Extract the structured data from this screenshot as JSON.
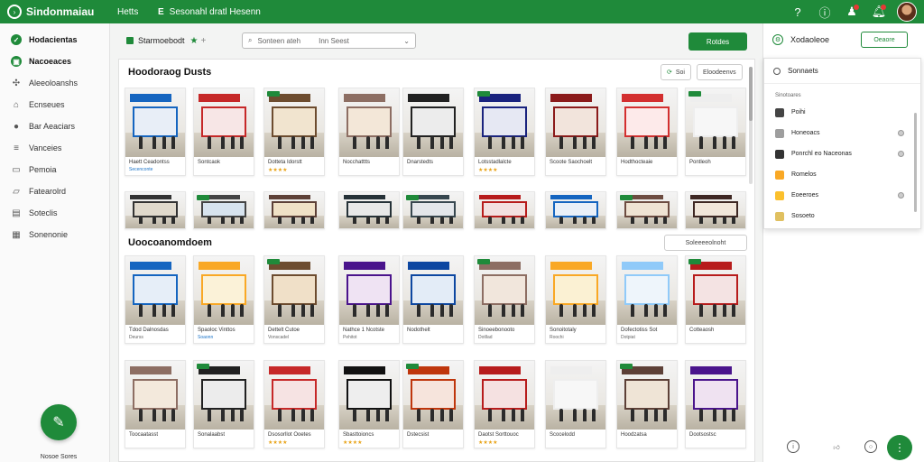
{
  "app": {
    "title": "Sindonmaiau",
    "links": [
      "Hetts",
      "E",
      "Sesonahl dratl Hesenn"
    ]
  },
  "sidebar": {
    "items": [
      {
        "label": "Hodacientas",
        "icon": "check-icon",
        "primary": true
      },
      {
        "label": "Nacoeaces",
        "icon": "store-icon",
        "primary": true
      },
      {
        "label": "Aleeoloanshs",
        "icon": "grid-icon",
        "primary": false
      },
      {
        "label": "Ecnseues",
        "icon": "home-icon",
        "primary": false
      },
      {
        "label": "Bar Aeaciars",
        "icon": "circle-icon",
        "primary": false
      },
      {
        "label": "Vanceies",
        "icon": "list-icon",
        "primary": false
      },
      {
        "label": "Pemoia",
        "icon": "doc-icon",
        "primary": false
      },
      {
        "label": "Fatearolrd",
        "icon": "folder-icon",
        "primary": false
      },
      {
        "label": "Soteclis",
        "icon": "table-icon",
        "primary": false
      },
      {
        "label": "Sonenonie",
        "icon": "settings-icon",
        "primary": false
      }
    ],
    "fab_label": "Nosoe Sores"
  },
  "toolbar": {
    "breadcrumb": "Starmoebodt",
    "search_text": "Sonteen ateh",
    "search_text2": "Inn Seest",
    "primary_button": "Rotdes"
  },
  "section1": {
    "title": "Hoodoraog Dusts",
    "btn_a": "Soi",
    "btn_b": "Eloodeenvs",
    "row1": [
      {
        "cap": "Haett Ceadontss",
        "sub": "Secenconte",
        "kind": "sub",
        "sign": "#1565c0",
        "win": "#e8eef7"
      },
      {
        "cap": "Sontcaok",
        "sub": "",
        "kind": "none",
        "sign": "#c62828",
        "win": "#f7e6e6"
      },
      {
        "cap": "Dotteta Idorstt",
        "sub": "★★★★",
        "kind": "stars",
        "sign": "#6d4c2f",
        "win": "#f1e4cf"
      },
      {
        "cap": "Nocchatttts",
        "sub": "",
        "kind": "none",
        "sign": "#8d6e63",
        "win": "#f3e7d8"
      },
      {
        "cap": "Dnarstedts",
        "sub": "",
        "kind": "none",
        "sign": "#212121",
        "win": "#ececec"
      },
      {
        "cap": "Lotsstadlalcte",
        "sub": "★★★★",
        "kind": "stars",
        "sign": "#1a237e",
        "win": "#e6e8f3"
      },
      {
        "cap": "Scoote Saochoelt",
        "sub": "",
        "kind": "none",
        "sign": "#8b1a1a",
        "win": "#f2e4dc"
      },
      {
        "cap": "Hodthocteaie",
        "sub": "",
        "kind": "none",
        "sign": "#d32f2f",
        "win": "#fdeaea"
      },
      {
        "cap": "Pontleoh",
        "sub": "",
        "kind": "none",
        "sign": "#eeeeee",
        "win": "#f7f7f7"
      }
    ],
    "row2": [
      {
        "sign": "#333333",
        "win": "#e0d9cc"
      },
      {
        "sign": "#444444",
        "win": "#d7e3ee"
      },
      {
        "sign": "#5d4037",
        "win": "#f0e1c6"
      },
      {
        "sign": "#263238",
        "win": "#e8e8e8"
      },
      {
        "sign": "#37474f",
        "win": "#e3e6ea"
      },
      {
        "sign": "#b71c1c",
        "win": "#f3e0e0"
      },
      {
        "sign": "#1565c0",
        "win": "#eaf0f8"
      },
      {
        "sign": "#6d4c41",
        "win": "#efe3d3"
      },
      {
        "sign": "#3e2723",
        "win": "#f1e6da"
      }
    ]
  },
  "section2": {
    "title": "Uoocoanomdoem",
    "btn": "Soleeeeolnoht",
    "row1": [
      {
        "cap": "Tdod Dalnosdas",
        "sub": "Deurss",
        "kind": "plain",
        "sign": "#1565c0",
        "win": "#e6eef8"
      },
      {
        "cap": "Spaoloc Vinttos",
        "sub": "Soaonn",
        "kind": "sub",
        "sign": "#f9a825",
        "win": "#fbf2d8"
      },
      {
        "cap": "Dettelt Cutoe",
        "sub": "Vonscadel",
        "kind": "plain",
        "sign": "#6d4c2f",
        "win": "#f0e0c8"
      },
      {
        "cap": "Nathce 1 Ncotste",
        "sub": "Pehitot",
        "kind": "plain",
        "sign": "#4a148c",
        "win": "#efe3f3"
      },
      {
        "cap": "Nodothelt",
        "sub": "",
        "kind": "none",
        "sign": "#0d47a1",
        "win": "#e3ecf7"
      },
      {
        "cap": "Sinoeebonooto",
        "sub": "Dotllad",
        "kind": "plain",
        "sign": "#8d6e63",
        "win": "#f1e6dc"
      },
      {
        "cap": "Sonoitotaly",
        "sub": "Roochi",
        "kind": "plain",
        "sign": "#f9a825",
        "win": "#fbf1d3"
      },
      {
        "cap": "Dofectotiss Sot",
        "sub": "Dotpiat",
        "kind": "plain",
        "sign": "#90caf9",
        "win": "#eef5fb"
      },
      {
        "cap": "Cotteaosh",
        "sub": "",
        "kind": "none",
        "sign": "#b71c1c",
        "win": "#f4e3e3"
      }
    ],
    "row2": [
      {
        "cap": "Toocaatasst",
        "sub": "",
        "kind": "none",
        "sign": "#8d6e63",
        "win": "#f3e9dc"
      },
      {
        "cap": "Sonalaabst",
        "sub": "",
        "kind": "none",
        "sign": "#212121",
        "win": "#ececec"
      },
      {
        "cap": "Dsosorllot Ooetes",
        "sub": "★★★★",
        "kind": "stars",
        "sign": "#c62828",
        "win": "#f6e3e3"
      },
      {
        "cap": "Sbasttoioncs",
        "sub": "★★★★",
        "kind": "stars",
        "sign": "#111111",
        "win": "#eeeeee"
      },
      {
        "cap": "Dstecsist",
        "sub": "",
        "kind": "none",
        "sign": "#bf360c",
        "win": "#f6e4dc"
      },
      {
        "cap": "Daotst Sorttouoc",
        "sub": "★★★★",
        "kind": "stars",
        "sign": "#b71c1c",
        "win": "#f5e1e1"
      },
      {
        "cap": "Scocelodd",
        "sub": "",
        "kind": "none",
        "sign": "#eeeeee",
        "win": "#f7f7f7"
      },
      {
        "cap": "Hoodzatsa",
        "sub": "",
        "kind": "none",
        "sign": "#5d4037",
        "win": "#efe4d6"
      },
      {
        "cap": "Dootsostsc",
        "sub": "",
        "kind": "none",
        "sign": "#4a148c",
        "win": "#efe2f1"
      }
    ]
  },
  "rightpanel": {
    "title": "Xodaoleoe",
    "button": "Oeaore",
    "dropdown_title": "Sonnaets",
    "section": "Sinotoares",
    "items": [
      {
        "label": "Poihi",
        "swatch": "#444444",
        "radio": false
      },
      {
        "label": "Honeoacs",
        "swatch": "#9e9e9e",
        "radio": true
      },
      {
        "label": "Ponrchl eo Naceonas",
        "swatch": "#333333",
        "radio": true
      },
      {
        "label": "Romelos",
        "swatch": "#f9a825",
        "radio": false
      },
      {
        "label": "Eoeeroes",
        "swatch": "#fbc02d",
        "radio": true
      },
      {
        "label": "Sosoeto",
        "swatch": "#e0c060",
        "radio": false
      }
    ]
  }
}
